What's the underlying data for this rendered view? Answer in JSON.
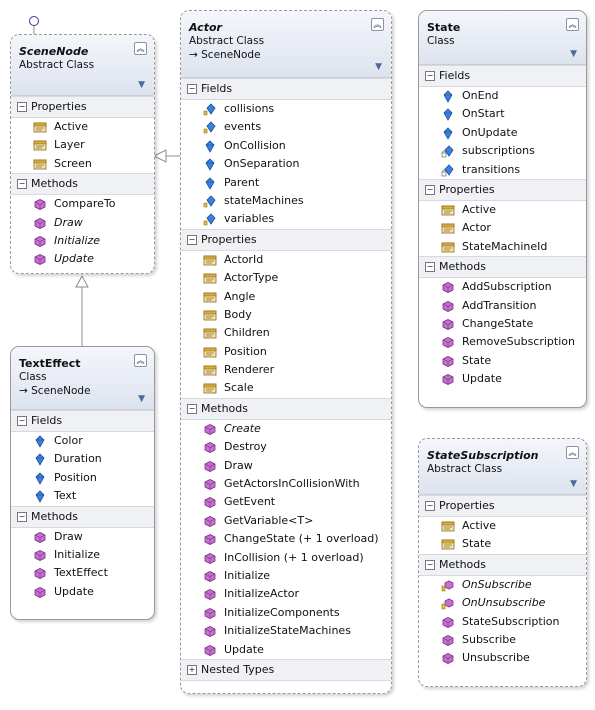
{
  "classes": {
    "scenenode": {
      "name": "SceneNode",
      "kind": "Abstract Class",
      "properties_title": "Properties",
      "methods_title": "Methods",
      "properties": [
        "Active",
        "Layer",
        "Screen"
      ],
      "methods": [
        "CompareTo",
        "Draw",
        "Initialize",
        "Update"
      ]
    },
    "texteffect": {
      "name": "TextEffect",
      "kind": "Class",
      "base": "SceneNode",
      "fields_title": "Fields",
      "methods_title": "Methods",
      "fields": [
        "Color",
        "Duration",
        "Position",
        "Text"
      ],
      "methods": [
        "Draw",
        "Initialize",
        "TextEffect",
        "Update"
      ]
    },
    "actor": {
      "name": "Actor",
      "kind": "Abstract Class",
      "base": "SceneNode",
      "fields_title": "Fields",
      "properties_title": "Properties",
      "methods_title": "Methods",
      "nested_title": "Nested Types",
      "fields": [
        "collisions",
        "events",
        "OnCollision",
        "OnSeparation",
        "Parent",
        "stateMachines",
        "variables"
      ],
      "properties": [
        "ActorId",
        "ActorType",
        "Angle",
        "Body",
        "Children",
        "Position",
        "Renderer",
        "Scale"
      ],
      "methods": [
        "Create",
        "Destroy",
        "Draw",
        "GetActorsInCollisionWith",
        "GetEvent",
        "GetVariable<T>",
        "ChangeState (+ 1 overload)",
        "InCollision (+ 1 overload)",
        "Initialize",
        "InitializeActor",
        "InitializeComponents",
        "InitializeStateMachines",
        "Update"
      ]
    },
    "state": {
      "name": "State",
      "kind": "Class",
      "fields_title": "Fields",
      "properties_title": "Properties",
      "methods_title": "Methods",
      "fields": [
        "OnEnd",
        "OnStart",
        "OnUpdate",
        "subscriptions",
        "transitions"
      ],
      "properties": [
        "Active",
        "Actor",
        "StateMachineId"
      ],
      "methods": [
        "AddSubscription",
        "AddTransition",
        "ChangeState",
        "RemoveSubscription",
        "State",
        "Update"
      ]
    },
    "statesubscription": {
      "name": "StateSubscription",
      "kind": "Abstract Class",
      "properties_title": "Properties",
      "methods_title": "Methods",
      "properties": [
        "Active",
        "State"
      ],
      "methods": [
        "OnSubscribe",
        "OnUnsubscribe",
        "StateSubscription",
        "Subscribe",
        "Unsubscribe"
      ]
    }
  },
  "colors": {
    "method_icon": "#b34fb3",
    "property_icon": "#c89a2a",
    "field_icon": "#2f6fd0",
    "connector": "#8c8c8c"
  }
}
